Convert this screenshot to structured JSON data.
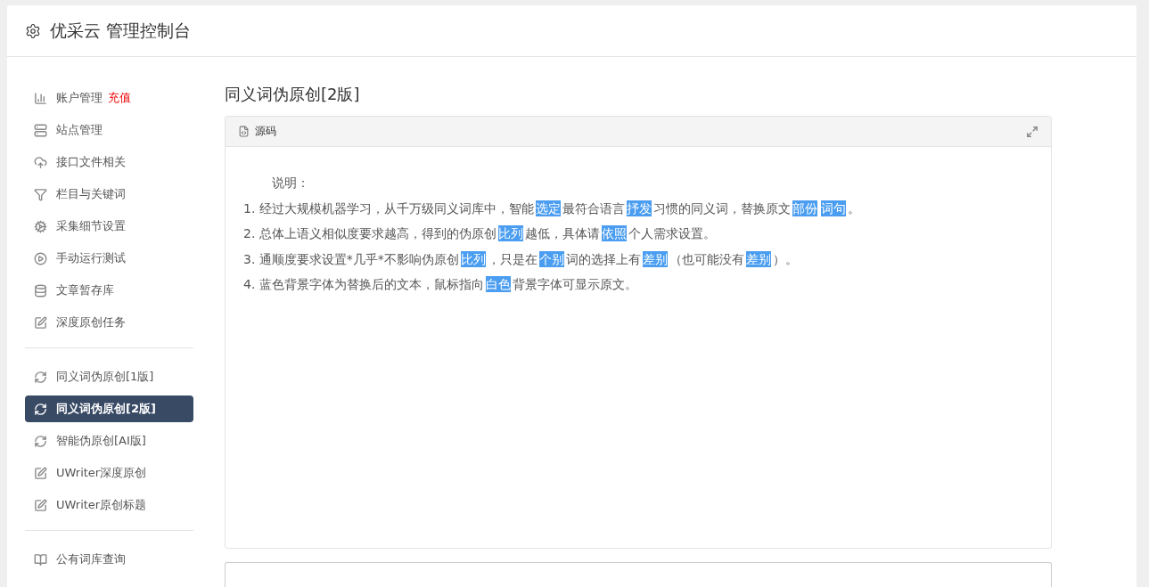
{
  "header": {
    "title": "优采云 管理控制台"
  },
  "sidebar": {
    "groups": [
      {
        "items": [
          {
            "label": "账户管理",
            "badge": "充值",
            "selected": false
          },
          {
            "label": "站点管理",
            "selected": false
          },
          {
            "label": "接口文件相关",
            "selected": false
          },
          {
            "label": "栏目与关键词",
            "selected": false
          },
          {
            "label": "采集细节设置",
            "selected": false
          },
          {
            "label": "手动运行测试",
            "selected": false
          },
          {
            "label": "文章暂存库",
            "selected": false
          },
          {
            "label": "深度原创任务",
            "selected": false
          }
        ]
      },
      {
        "items": [
          {
            "label": "同义词伪原创[1版]",
            "selected": false
          },
          {
            "label": "同义词伪原创[2版]",
            "selected": true
          },
          {
            "label": "智能伪原创[AI版]",
            "selected": false
          },
          {
            "label": "UWriter深度原创",
            "selected": false
          },
          {
            "label": "UWriter原创标题",
            "selected": false
          }
        ]
      },
      {
        "items": [
          {
            "label": "公有词库查询",
            "selected": false
          }
        ]
      }
    ]
  },
  "main": {
    "title": "同义词伪原创[2版]",
    "panel": {
      "title": "源码",
      "heading": "说明：",
      "lines": [
        {
          "segments": [
            {
              "text": "1. 经过大规模机器学习，从千万级同义词库中，智能",
              "highlighted": false
            },
            {
              "text": "选定",
              "highlighted": true
            },
            {
              "text": "最符合语言",
              "highlighted": false
            },
            {
              "text": "抒发",
              "highlighted": true
            },
            {
              "text": "习惯的同义词，替换原文",
              "highlighted": false
            },
            {
              "text": "部份",
              "highlighted": true
            },
            {
              "text": "词句",
              "highlighted": true
            },
            {
              "text": "。",
              "highlighted": false
            }
          ]
        },
        {
          "segments": [
            {
              "text": "2. 总体上语义相似度要求越高，得到的伪原创",
              "highlighted": false
            },
            {
              "text": "比列",
              "highlighted": true
            },
            {
              "text": "越低，具体请",
              "highlighted": false
            },
            {
              "text": "依照",
              "highlighted": true
            },
            {
              "text": "个人需求设置。",
              "highlighted": false
            }
          ]
        },
        {
          "segments": [
            {
              "text": "3. 通顺度要求设置*几乎*不影响伪原创",
              "highlighted": false
            },
            {
              "text": "比列",
              "highlighted": true
            },
            {
              "text": "，只是在",
              "highlighted": false
            },
            {
              "text": "个别",
              "highlighted": true
            },
            {
              "text": "词的选择上有",
              "highlighted": false
            },
            {
              "text": "差别",
              "highlighted": true
            },
            {
              "text": "（也可能没有",
              "highlighted": false
            },
            {
              "text": "差别",
              "highlighted": true
            },
            {
              "text": "）。",
              "highlighted": false
            }
          ]
        },
        {
          "segments": [
            {
              "text": "4. 蓝色背景字体为替换后的文本，鼠标指向",
              "highlighted": false
            },
            {
              "text": "白色",
              "highlighted": true
            },
            {
              "text": "背景字体可显示原文。",
              "highlighted": false
            }
          ]
        }
      ]
    }
  }
}
